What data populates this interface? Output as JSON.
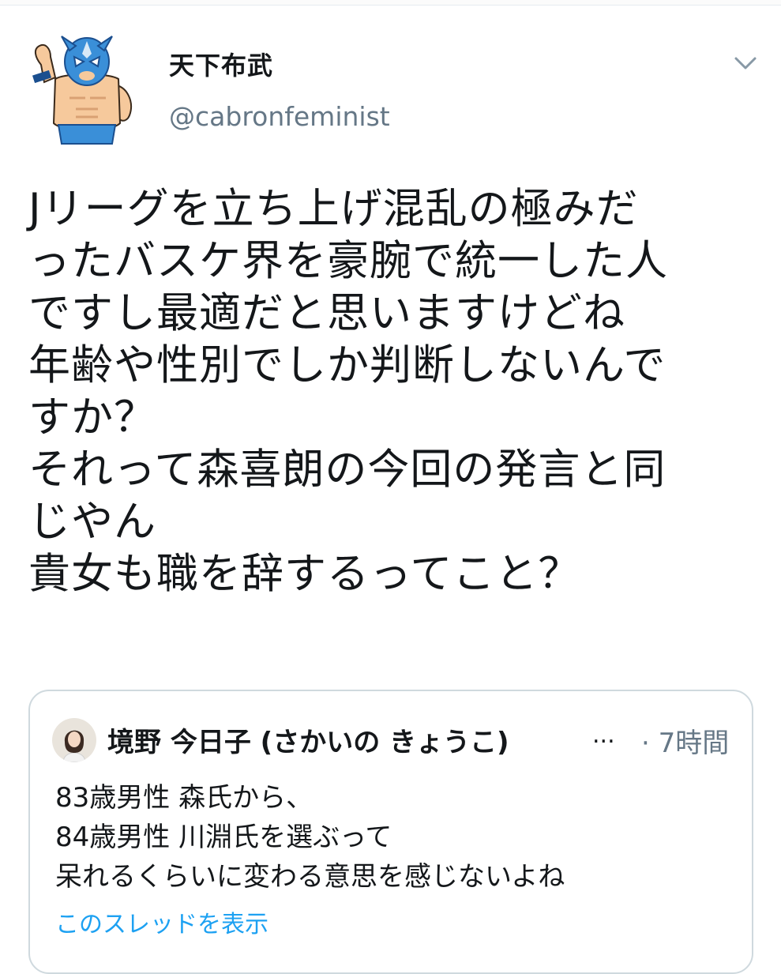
{
  "tweet": {
    "author_name": "天下布武",
    "author_handle": "@cabronfeminist",
    "avatar_icon": "masked-wrestler-avatar",
    "menu_icon": "chevron-down-icon",
    "body_lines": [
      "Jリーグを立ち上げ混乱の極みだ",
      "ったバスケ界を豪腕で統一した人",
      "ですし最適だと思いますけどね",
      "年齢や性別でしか判断しないんで",
      "すか？",
      "それって森喜朗の今回の発言と同",
      "じやん",
      "貴女も職を辞するってこと？"
    ]
  },
  "quoted_tweet": {
    "author_name": "境野 今日子 (さかいの きょうこ)",
    "ellipsis": "...",
    "time": "· 7時間",
    "avatar_icon": "profile-photo-avatar",
    "body_lines": [
      "83歳男性 森氏から、",
      "84歳男性 川淵氏を選ぶって",
      "呆れるくらいに変わる意思を感じないよね"
    ],
    "show_thread_label": "このスレッドを表示"
  },
  "colors": {
    "text": "#14171a",
    "secondary": "#657786",
    "link": "#1da1f2",
    "border": "#cfd9de"
  }
}
